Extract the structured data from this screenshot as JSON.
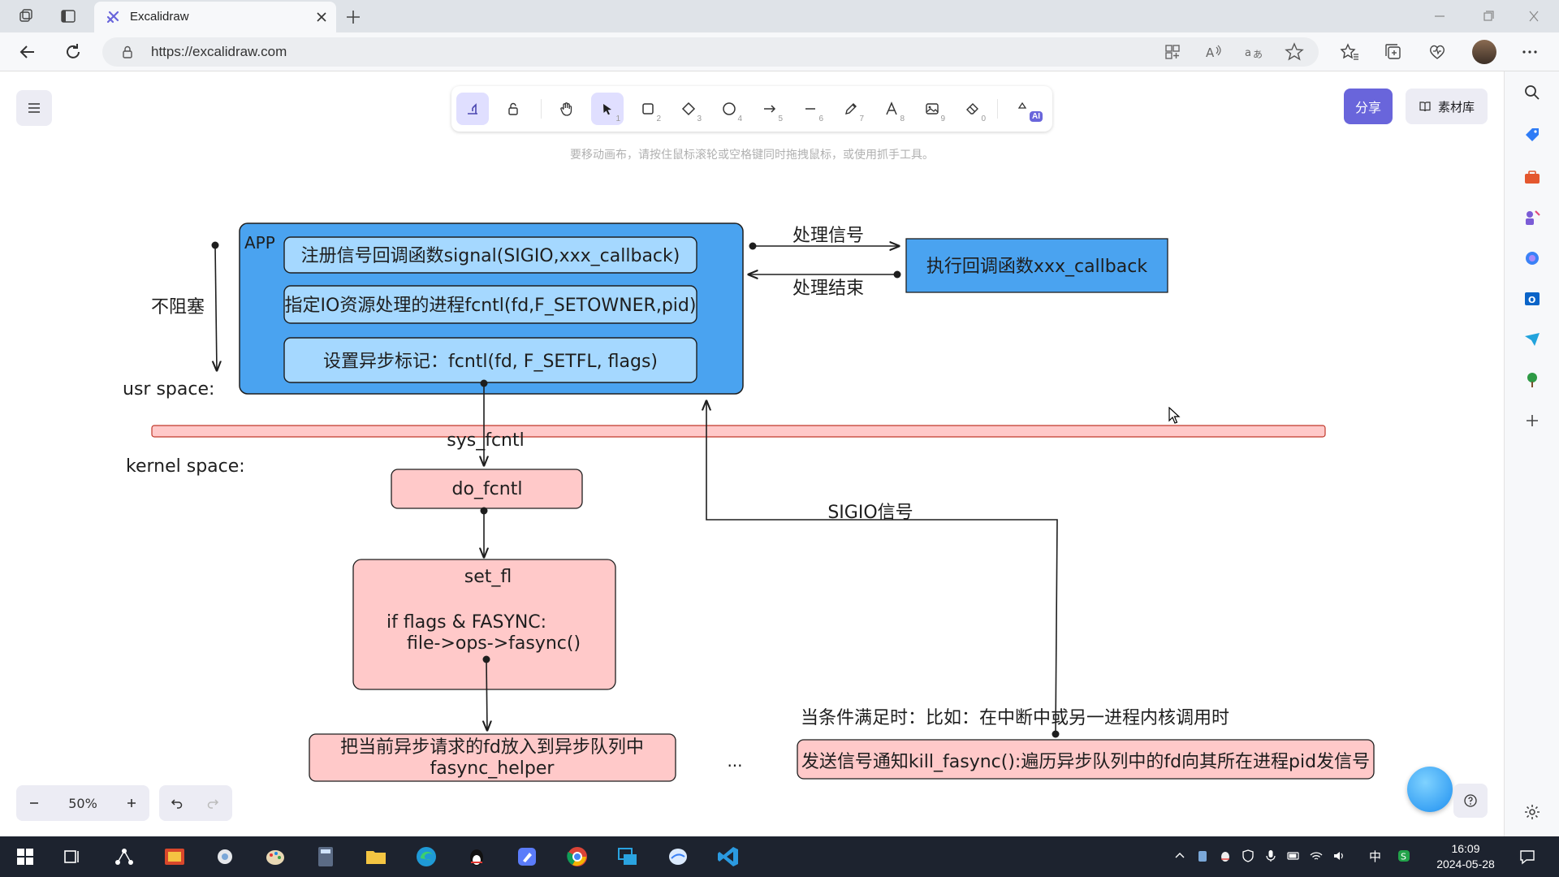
{
  "browser": {
    "tab_title": "Excalidraw",
    "url": "https://excalidraw.com"
  },
  "app": {
    "share_label": "分享",
    "library_label": "素材库",
    "hint": "要移动画布，请按住鼠标滚轮或空格键同时拖拽鼠标，或使用抓手工具。",
    "zoom_level": "50%",
    "ai_badge": "AI",
    "toolbar_keys": [
      "1",
      "2",
      "3",
      "4",
      "5",
      "6",
      "7",
      "8",
      "9",
      "0"
    ],
    "accent_color": "#6965db"
  },
  "diagram": {
    "nonblocking_label": "不阻塞",
    "usr_space_label": "usr space:",
    "kernel_space_label": "kernel space:",
    "app_label": "APP",
    "app_steps": [
      "注册信号回调函数signal(SIGIO,xxx_callback)",
      "指定IO资源处理的进程fcntl(fd,F_SETOWNER,pid)",
      "设置异步标记：fcntl(fd, F_SETFL, flags)"
    ],
    "handle_signal_label": "处理信号",
    "handle_done_label": "处理结束",
    "callback_box": "执行回调函数xxx_callback",
    "sys_fcntl_label": "sys_fcntl",
    "do_fcntl_box": "do_fcntl",
    "set_fl_title": "set_fl",
    "set_fl_line1": "if flags & FASYNC:",
    "set_fl_line2": "file->ops->fasync()",
    "fasync_line1": "把当前异步请求的fd放入到异步队列中",
    "fasync_line2": "fasync_helper",
    "ellipsis": "...",
    "sigio_label": "SIGIO信号",
    "condition_label": "当条件满足时：比如：在中断中或另一进程内核调用时",
    "kill_fasync_box": "发送信号通知kill_fasync():遍历异步队列中的fd向其所在进程pid发信号",
    "colors": {
      "app_fill": "#4aa3f0",
      "app_inner_fill": "#a5d8ff",
      "callback_fill": "#4aa3f0",
      "kernel_fill": "#ffc9c9",
      "boundary_fill": "#ffc9c9",
      "kernel_stroke": "#c0392b"
    }
  },
  "taskbar": {
    "time": "16:09",
    "date": "2024-05-28",
    "ime": "中"
  }
}
